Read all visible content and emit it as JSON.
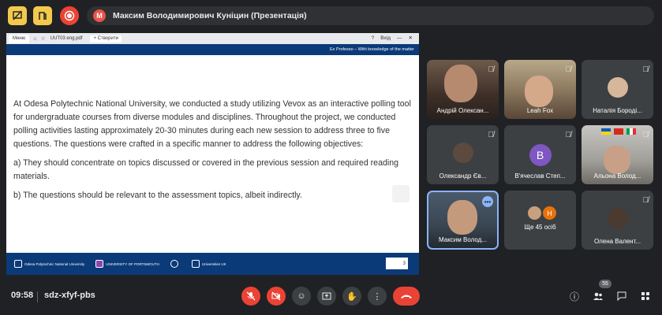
{
  "top": {
    "meeting_title": "Максим Володимирович Куніцин (Презентація)",
    "presenter_initial": "М",
    "icons": [
      "presentation-off-icon",
      "present-stop-icon",
      "record-icon"
    ]
  },
  "browser": {
    "tab_left": "Меню",
    "tab_pdf": "UUT03 eng.pdf",
    "new_tab": "+ Створити",
    "signin": "Вхід"
  },
  "slide": {
    "tagline": "Ex Professo – With knowledge of the matter",
    "paragraph1": "At Odesa Polytechnic National University, we conducted a study utilizing Vevox as an interactive polling tool for undergraduate courses from diverse modules and disciplines. Throughout the project, we conducted polling activities lasting approximately 20-30 minutes during each new session to address three to five questions. The questions were crafted in a specific manner to address the following objectives:",
    "paragraph2": "a) They should concentrate on topics discussed or covered in the previous session and required reading materials.",
    "paragraph3": "b) The questions should be relevant to the assessment topics, albeit indirectly.",
    "page_number": "3",
    "footer_logos": [
      "Odesa Polytechnic National University",
      "UNIVERSITY OF PORTSMOUTH",
      "",
      "Universities UK"
    ]
  },
  "participants": [
    {
      "name": "Андрій Олексан...",
      "muted": true
    },
    {
      "name": "Leah Fox",
      "muted": true
    },
    {
      "name": "Наталія Бороді...",
      "muted": true
    },
    {
      "name": "Олександр Єв...",
      "muted": true
    },
    {
      "name": "В'ячеслав Степ...",
      "muted": true,
      "initial": "В"
    },
    {
      "name": "Альона Волод...",
      "muted": true
    },
    {
      "name": "Максим Волод...",
      "muted": false
    },
    {
      "name": "Ще 45 осіб",
      "muted": false,
      "initial": "Н"
    },
    {
      "name": "Олена Валент...",
      "muted": true
    }
  ],
  "bottom": {
    "time": "09:58",
    "meeting_code": "sdz-xfyf-pbs",
    "people_count": "55",
    "colors": {
      "danger": "#ea4335",
      "accent": "#8ab4f8",
      "surface": "#3c4043"
    }
  }
}
